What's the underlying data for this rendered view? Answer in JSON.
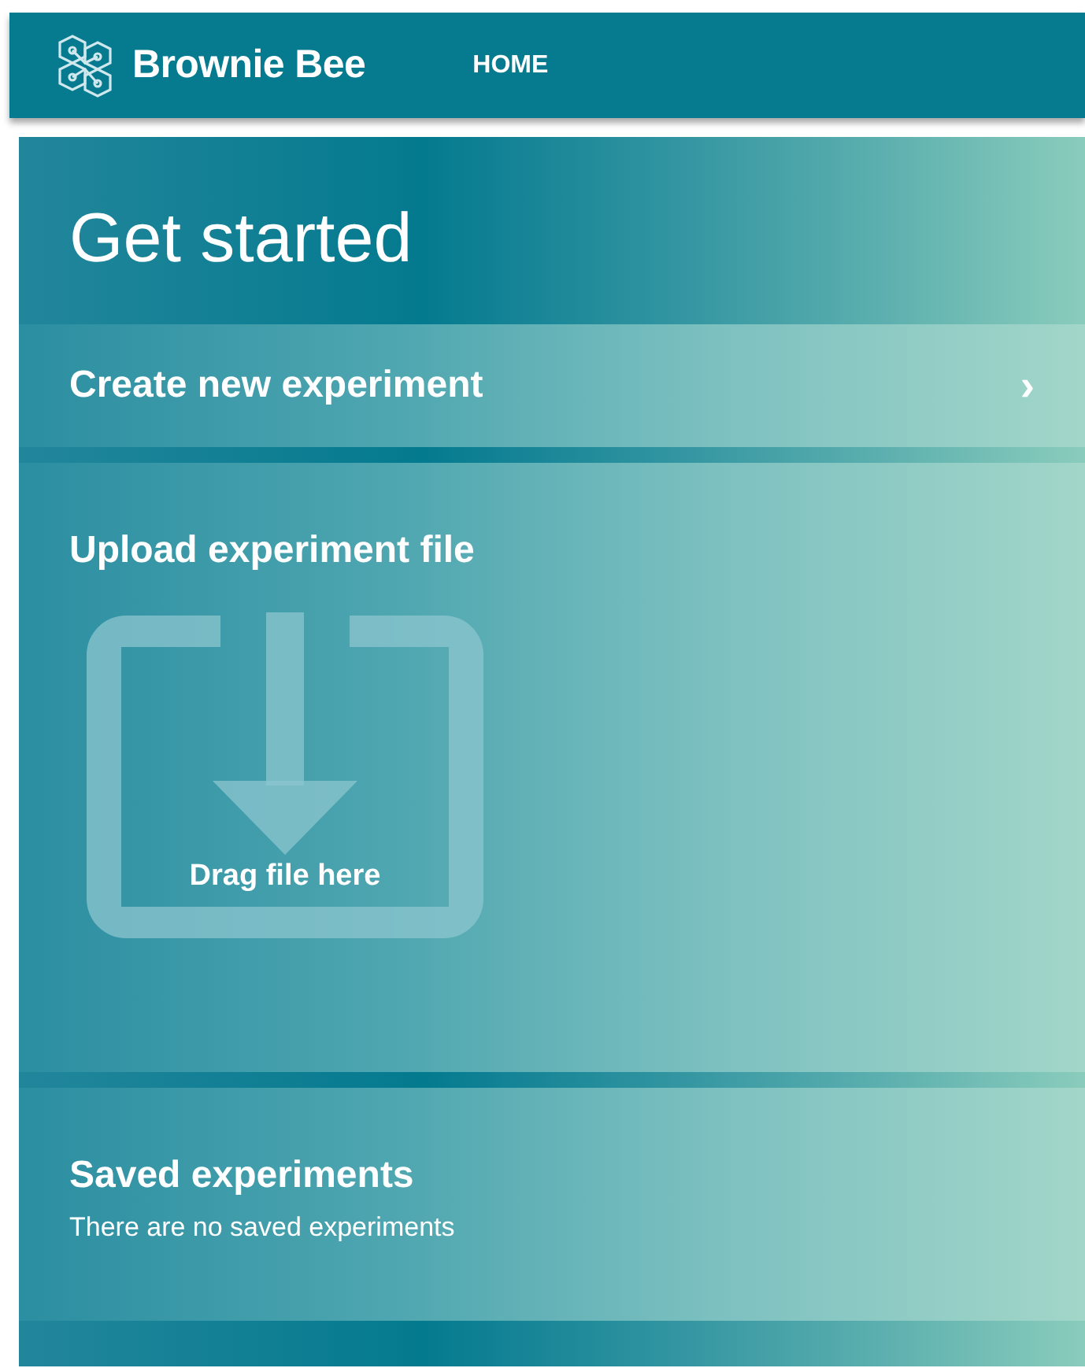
{
  "navbar": {
    "brand": "Brownie Bee",
    "links": [
      {
        "label": "HOME",
        "selected": true
      }
    ]
  },
  "header": {
    "title": "Get started"
  },
  "create": {
    "label": "Create new experiment",
    "chevron": "›"
  },
  "upload": {
    "title": "Upload experiment file",
    "drop_label": "Drag file here"
  },
  "saved": {
    "title": "Saved experiments",
    "empty_text": "There are no saved experiments"
  }
}
